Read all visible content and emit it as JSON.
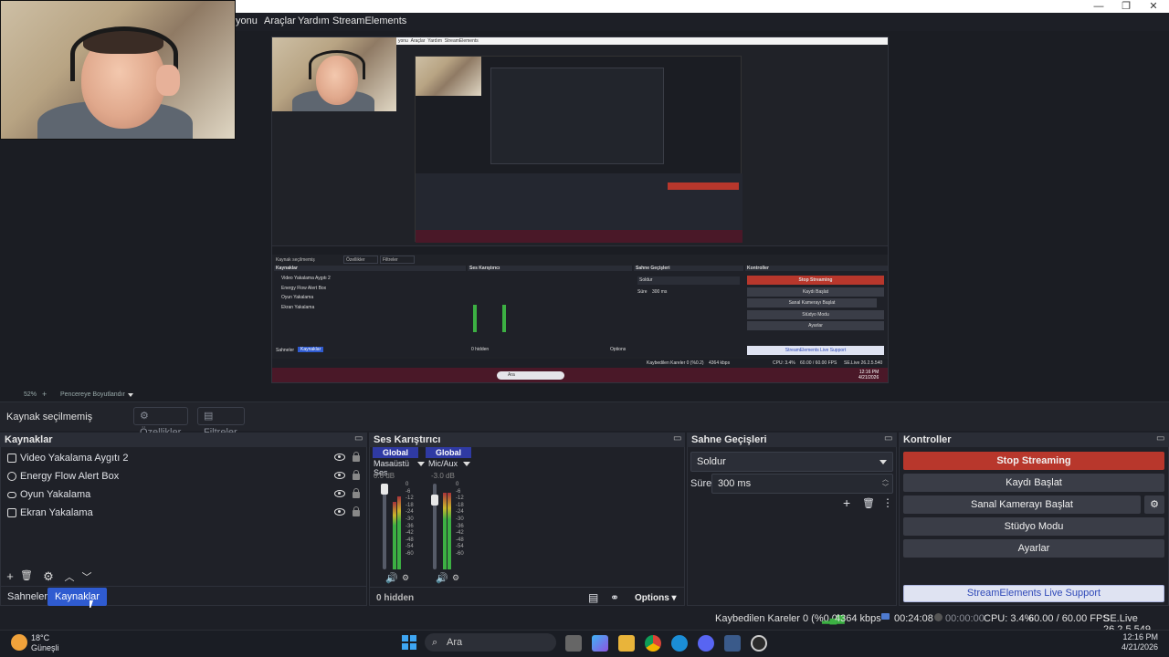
{
  "menu": {
    "items": [
      "yonu",
      "Araçlar",
      "Yardım",
      "StreamElements"
    ]
  },
  "window_controls": {
    "minimize": "—",
    "maximize": "❐",
    "close": "✕"
  },
  "nested_preview": {
    "menu": [
      "yonu",
      "Araçlar",
      "Yardım",
      "StreamElements"
    ],
    "source_status": "Kaynak seçilmemiş",
    "properties": "Özellikler",
    "filters": "Filtreler",
    "docks": [
      "Kaynaklar",
      "Ses Karıştırıcı",
      "Sahne Geçişleri",
      "Kontroller"
    ],
    "sources": [
      "Video Yakalama Aygıtı 2",
      "Energy Flow Alert Box",
      "Oyun Yakalama",
      "Ekran Yakalama"
    ],
    "tabs": [
      "Sahneler",
      "Kaynaklar"
    ],
    "controls": [
      "Stop Streaming",
      "Kaydı Başlat",
      "Sanal Kamerayı Başlat",
      "Stüdyo Modu",
      "Ayarlar"
    ],
    "support": "StreamElements Live Support",
    "transition": "Soldur",
    "duration_label": "Süre",
    "duration": "300 ms",
    "hidden": "0 hidden",
    "options": "Options",
    "status": "Kaybedilen Kareler 0 (%0.2)",
    "kbps": "4364 kbps",
    "cpu": "CPU: 3.4%",
    "fps": "60.00 / 60.00 FPS",
    "version": "SE.Live 26.2.5.540",
    "search": "Ara",
    "clock_time": "12:16 PM",
    "clock_date": "4/21/2026"
  },
  "zoom": {
    "level": "52%",
    "mode": "Pencereye Boyutlandır"
  },
  "source_toolbar": {
    "status": "Kaynak seçilmemiş",
    "properties_label": "Özellikler",
    "filters_label": "Filtreler"
  },
  "sources_dock": {
    "title": "Kaynaklar",
    "items": [
      {
        "label": "Video Yakalama Aygıtı 2",
        "icon": "camera-icon"
      },
      {
        "label": "Energy Flow Alert Box",
        "icon": "browser-icon"
      },
      {
        "label": "Oyun Yakalama",
        "icon": "gamepad-icon"
      },
      {
        "label": "Ekran Yakalama",
        "icon": "monitor-icon"
      }
    ],
    "tabs": [
      "Sahneler",
      "Kaynaklar"
    ]
  },
  "mixer_dock": {
    "title": "Ses Karıştırıcı",
    "channels": [
      {
        "badge": "Global",
        "name": "Masaüstü Ses",
        "db": "0.0 dB"
      },
      {
        "badge": "Global",
        "name": "Mic/Aux",
        "db": "-3.0 dB"
      }
    ],
    "scale": [
      "0",
      "-6",
      "-12",
      "-18",
      "-24",
      "-30",
      "-36",
      "-42",
      "-48",
      "-54",
      "-60"
    ],
    "hidden_label": "0 hidden",
    "options_label": "Options"
  },
  "transitions_dock": {
    "title": "Sahne Geçişleri",
    "transition": "Soldur",
    "duration_label": "Süre",
    "duration": "300 ms"
  },
  "controls_dock": {
    "title": "Kontroller",
    "stop_streaming": "Stop Streaming",
    "start_recording": "Kaydı Başlat",
    "virtual_camera": "Sanal Kamerayı Başlat",
    "studio_mode": "Stüdyo Modu",
    "settings": "Ayarlar",
    "support": "StreamElements Live Support"
  },
  "status_bar": {
    "dropped_frames": "Kaybedilen Kareler 0 (%0.0)",
    "kbps": "4364 kbps",
    "stream_time": "00:24:08",
    "record_time": "00:00:00",
    "cpu": "CPU: 3.4%",
    "fps": "60.00 / 60.00 FPS",
    "version": "SE.Live 26.2.5.549"
  },
  "taskbar": {
    "weather_temp": "18°C",
    "weather_desc": "Güneşli",
    "search_placeholder": "Ara",
    "time": "12:16 PM",
    "date": "4/21/2026"
  },
  "colors": {
    "accent": "#2f5bd0",
    "stop_red": "#b8372c",
    "meter_green": "#3cb043",
    "meter_yellow": "#c9b72b",
    "meter_red": "#a8323a"
  }
}
